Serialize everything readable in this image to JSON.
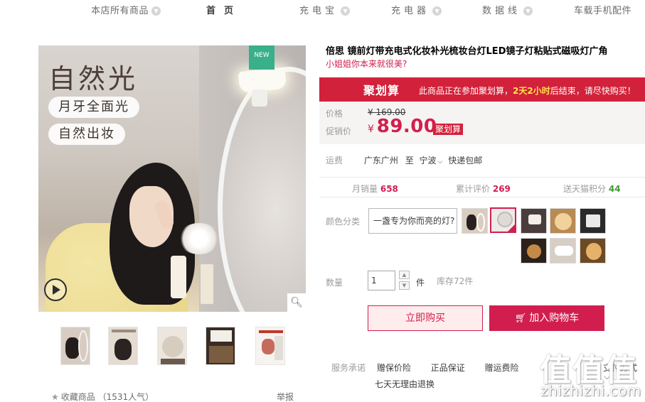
{
  "nav": {
    "items": [
      {
        "label": "本店所有商品"
      },
      {
        "label": "首页"
      },
      {
        "label": "充电宝"
      },
      {
        "label": "充电器"
      },
      {
        "label": "数据线"
      },
      {
        "label": "车载手机配件"
      }
    ]
  },
  "gallery": {
    "headline": "自然光",
    "tag1": "月牙全面光",
    "tag2": "自然出妆",
    "new_badge": "NEW",
    "thumbnail_count": 5
  },
  "favorite": {
    "label": "收藏商品",
    "popularity": "（1531人气）"
  },
  "report_label": "举报",
  "product": {
    "title": "倍思 镜前灯带充电式化妆补光梳妆台灯LED镜子灯粘贴式磁吸灯广角",
    "subtitle": "小姐姐你本来就很美?"
  },
  "promo": {
    "logo": "聚划算",
    "notice_prefix": "此商品正在参加聚划算，",
    "notice_highlight": "2天2小时",
    "notice_suffix": "后结束，请尽快购买！"
  },
  "price": {
    "label": "价格",
    "original": "¥ 169.00",
    "promo_label": "促销价",
    "currency": "¥",
    "promo_value": "89.00",
    "promo_tag": "聚划算"
  },
  "shipping": {
    "label": "运费",
    "from": "广东广州",
    "to_word": "至",
    "to_city": "宁波",
    "note": "快递包邮"
  },
  "stats": {
    "monthly_sales_label": "月销量",
    "monthly_sales": "658",
    "reviews_label": "累计评价",
    "reviews": "269",
    "points_label": "送天猫积分",
    "points": "44"
  },
  "color": {
    "label": "颜色分类",
    "text_option": "一盏专为你而亮的灯?",
    "swatch_count": 9,
    "selected_index": 1
  },
  "quantity": {
    "label": "数量",
    "value": "1",
    "unit": "件",
    "stock": "库存72件"
  },
  "actions": {
    "buy_now": "立即购买",
    "add_to_cart": "加入购物车"
  },
  "services": {
    "label": "服务承诺",
    "items": [
      "赠保价险",
      "正品保证",
      "赠运费险"
    ],
    "extra": "七天无理由退换",
    "payment": "支付方式"
  },
  "watermark": {
    "logo": "值值值",
    "url": "zhizhizhi.com"
  },
  "colors": {
    "accent": "#d21e4e",
    "promo_banner": "#d2213a",
    "points": "#3f9c35",
    "new_badge": "#39b08a"
  }
}
